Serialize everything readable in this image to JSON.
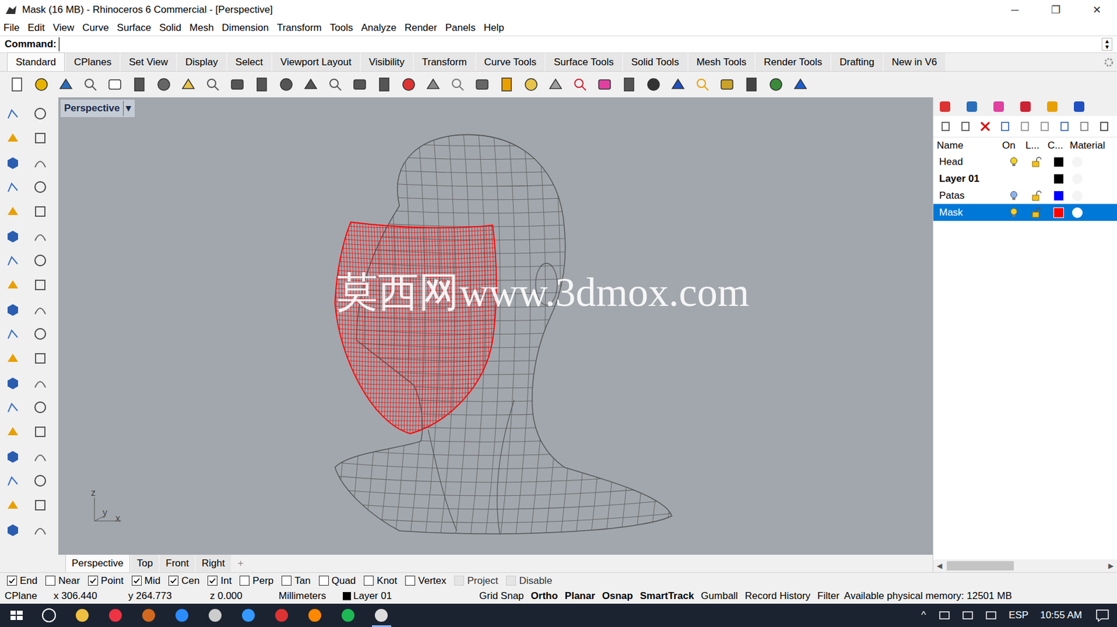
{
  "window": {
    "title": "Mask (16 MB) - Rhinoceros 6 Commercial - [Perspective]",
    "controls": [
      "─",
      "❐",
      "✕"
    ]
  },
  "menu": [
    "File",
    "Edit",
    "View",
    "Curve",
    "Surface",
    "Solid",
    "Mesh",
    "Dimension",
    "Transform",
    "Tools",
    "Analyze",
    "Render",
    "Panels",
    "Help"
  ],
  "command": {
    "label": "Command:",
    "value": ""
  },
  "toolbar_tabs": [
    {
      "label": "Standard",
      "selected": true
    },
    {
      "label": "CPlanes",
      "selected": false
    },
    {
      "label": "Set View",
      "selected": false
    },
    {
      "label": "Display",
      "selected": false
    },
    {
      "label": "Select",
      "selected": false
    },
    {
      "label": "Viewport Layout",
      "selected": false
    },
    {
      "label": "Visibility",
      "selected": false
    },
    {
      "label": "Transform",
      "selected": false
    },
    {
      "label": "Curve Tools",
      "selected": false
    },
    {
      "label": "Surface Tools",
      "selected": false
    },
    {
      "label": "Solid Tools",
      "selected": false
    },
    {
      "label": "Mesh Tools",
      "selected": false
    },
    {
      "label": "Render Tools",
      "selected": false
    },
    {
      "label": "Drafting",
      "selected": false
    },
    {
      "label": "New in V6",
      "selected": false
    }
  ],
  "viewport": {
    "label": "Perspective",
    "dropdown": "▾",
    "watermark": "莫西网www.3dmox.com",
    "axes": [
      "z",
      "y",
      "x"
    ]
  },
  "layers": {
    "columns": [
      "Name",
      "On",
      "L...",
      "C...",
      "Material"
    ],
    "rows": [
      {
        "name": "Head",
        "on": true,
        "locked": false,
        "color": "#000000",
        "current": false,
        "selected": false,
        "show_state": true
      },
      {
        "name": "Layer 01",
        "on": true,
        "locked": false,
        "color": "#000000",
        "current": true,
        "selected": false,
        "show_state": false
      },
      {
        "name": "Patas",
        "on": true,
        "locked": false,
        "color": "#0000ff",
        "current": false,
        "selected": false,
        "show_state": true
      },
      {
        "name": "Mask",
        "on": true,
        "locked": false,
        "color": "#ff0000",
        "current": false,
        "selected": true,
        "show_state": true
      }
    ]
  },
  "viewport_tabs": [
    {
      "label": "Perspective",
      "selected": true
    },
    {
      "label": "Top",
      "selected": false
    },
    {
      "label": "Front",
      "selected": false
    },
    {
      "label": "Right",
      "selected": false
    },
    {
      "label": "+",
      "selected": false
    }
  ],
  "osnaps": [
    {
      "label": "End",
      "checked": true,
      "disabled": false
    },
    {
      "label": "Near",
      "checked": false,
      "disabled": false
    },
    {
      "label": "Point",
      "checked": true,
      "disabled": false
    },
    {
      "label": "Mid",
      "checked": true,
      "disabled": false
    },
    {
      "label": "Cen",
      "checked": true,
      "disabled": false
    },
    {
      "label": "Int",
      "checked": true,
      "disabled": false
    },
    {
      "label": "Perp",
      "checked": false,
      "disabled": false
    },
    {
      "label": "Tan",
      "checked": false,
      "disabled": false
    },
    {
      "label": "Quad",
      "checked": false,
      "disabled": false
    },
    {
      "label": "Knot",
      "checked": false,
      "disabled": false
    },
    {
      "label": "Vertex",
      "checked": false,
      "disabled": false
    },
    {
      "label": "Project",
      "checked": false,
      "disabled": true
    },
    {
      "label": "Disable",
      "checked": false,
      "disabled": true
    }
  ],
  "status_bar": {
    "cplane": "CPlane",
    "x": "x 306.440",
    "y": "y 264.773",
    "z": "z 0.000",
    "units": "Millimeters",
    "layer": {
      "name": "Layer 01",
      "color": "#000000"
    },
    "toggles": [
      {
        "label": "Grid Snap",
        "on": false
      },
      {
        "label": "Ortho",
        "on": true
      },
      {
        "label": "Planar",
        "on": true
      },
      {
        "label": "Osnap",
        "on": true
      },
      {
        "label": "SmartTrack",
        "on": true
      },
      {
        "label": "Gumball",
        "on": false
      },
      {
        "label": "Record History",
        "on": false
      },
      {
        "label": "Filter",
        "on": false
      }
    ],
    "memory": "Available physical memory: 12501 MB"
  },
  "taskbar": {
    "caret": "^",
    "language": "ESP",
    "time": "10:55 AM"
  }
}
